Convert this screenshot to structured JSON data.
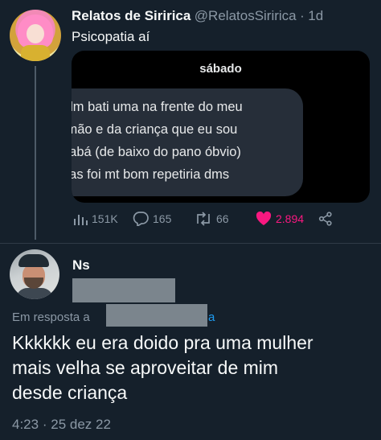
{
  "tweet": {
    "author_name": "Relatos de Siririca",
    "author_handle": "@RelatosSiririca",
    "separator": "·",
    "age": "1d",
    "text": "Psicopatia aí",
    "media": {
      "date": "sábado",
      "lines": [
        "ıdm bati uma na frente do meu",
        "rmão e da criança que eu sou",
        "babá (de baixo do pano óbvio)",
        "nas foi mt bom repetiria dms"
      ]
    },
    "actions": {
      "views": "151K",
      "replies": "165",
      "retweets": "66",
      "likes": "2.894"
    }
  },
  "reply": {
    "author_name": "Ns",
    "in_reply_prefix": "Em resposta a",
    "in_reply_suffix": "a",
    "text_lines": [
      "Kkkkkk eu era doido pra uma mulher",
      "mais velha se aproveitar de mim",
      "desde criança"
    ],
    "time": "4:23",
    "separator": "·",
    "date": "25 dez 22"
  },
  "colors": {
    "background": "#15202b",
    "text": "#f7f9f9",
    "secondary": "#8b98a5",
    "accent": "#1d9bf0",
    "like": "#f91880"
  },
  "icons": [
    "analytics-icon",
    "reply-icon",
    "retweet-icon",
    "heart-icon",
    "share-icon"
  ]
}
